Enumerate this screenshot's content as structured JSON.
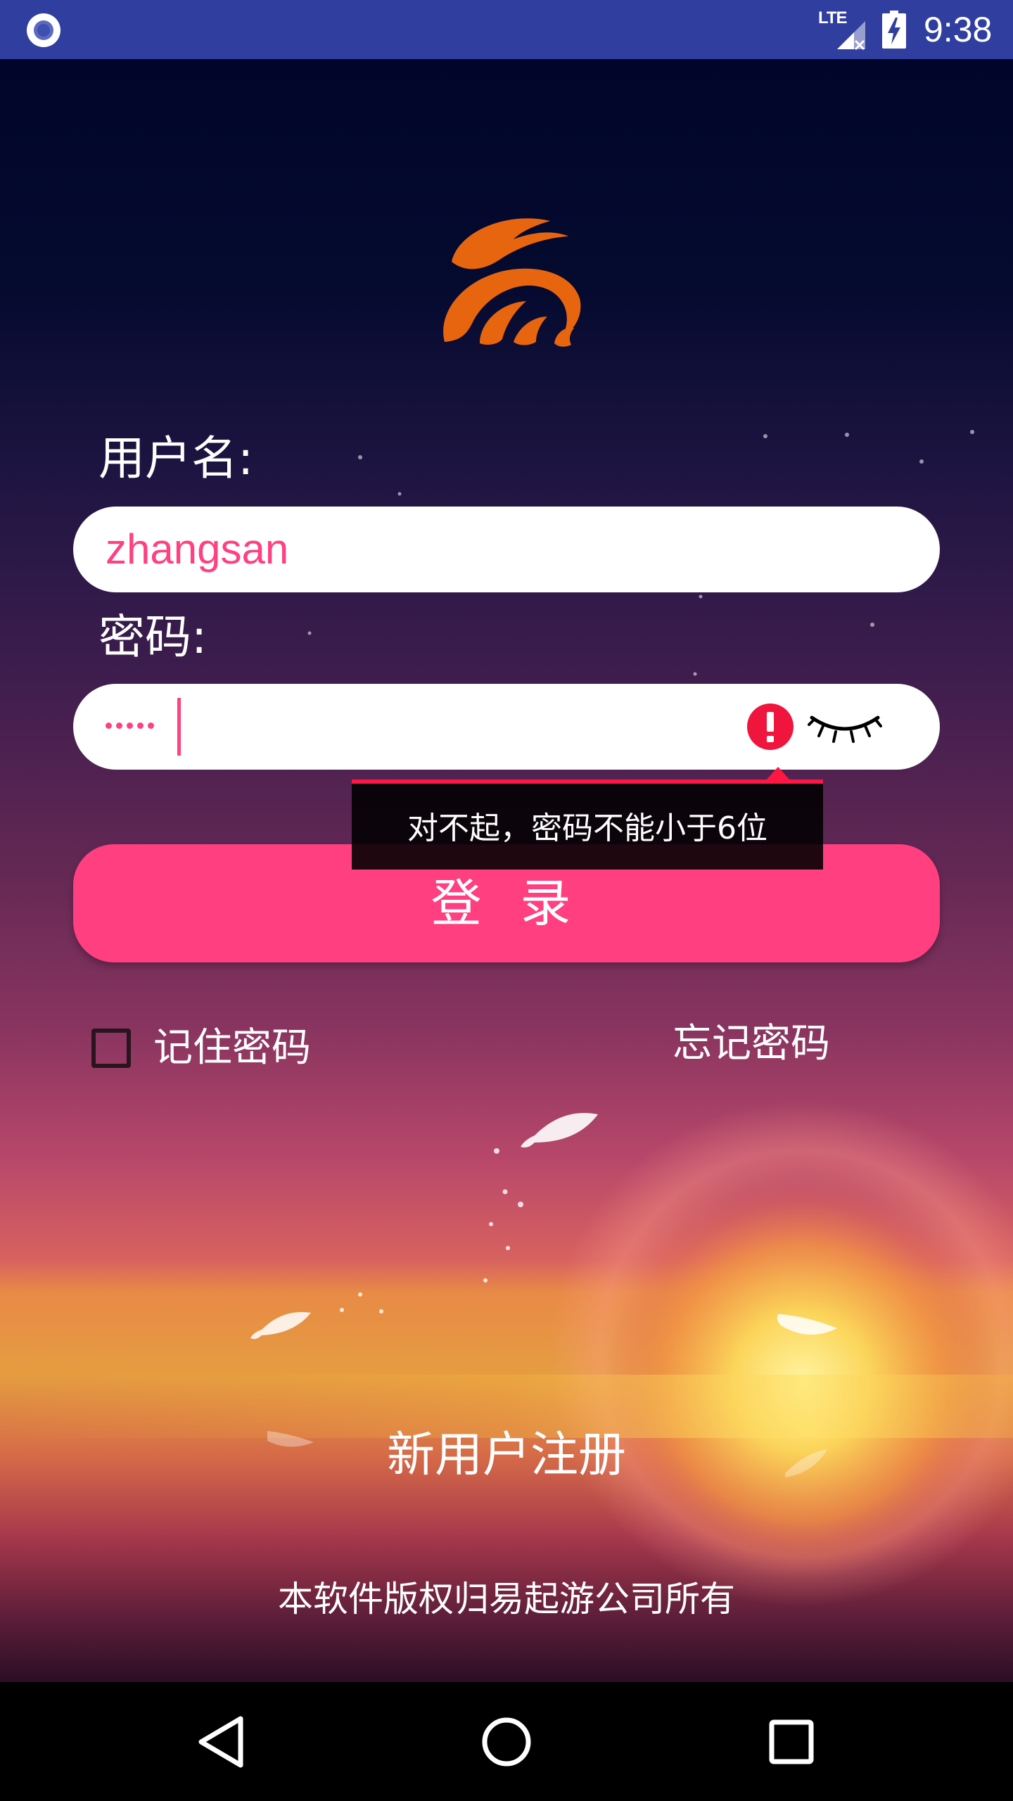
{
  "status_bar": {
    "time": "9:38",
    "network": "LTE",
    "icons": [
      "app-notification-icon",
      "signal-lte-icon",
      "battery-charging-icon"
    ],
    "color": "#303f9f"
  },
  "logo": {
    "icon": "rabbit-logo-icon",
    "color": "#e8650f"
  },
  "form": {
    "username_label": "用户名:",
    "username_value": "zhangsan",
    "password_label": "密码:",
    "password_masked_length": 5,
    "error_icon": "error-icon",
    "visibility_icon": "eye-closed-icon",
    "error_message": "对不起，密码不能小于6位",
    "login_label": "登 录",
    "remember_label": "记住密码",
    "remember_checked": false,
    "forgot_label": "忘记密码"
  },
  "footer": {
    "register_label": "新用户注册",
    "copyright": "本软件版权归易起游公司所有"
  },
  "nav_bar": {
    "buttons": [
      "back-icon",
      "home-icon",
      "recent-apps-icon"
    ]
  },
  "colors": {
    "accent": "#ff4081",
    "button": "#ff3f80",
    "error": "#ff1744"
  }
}
